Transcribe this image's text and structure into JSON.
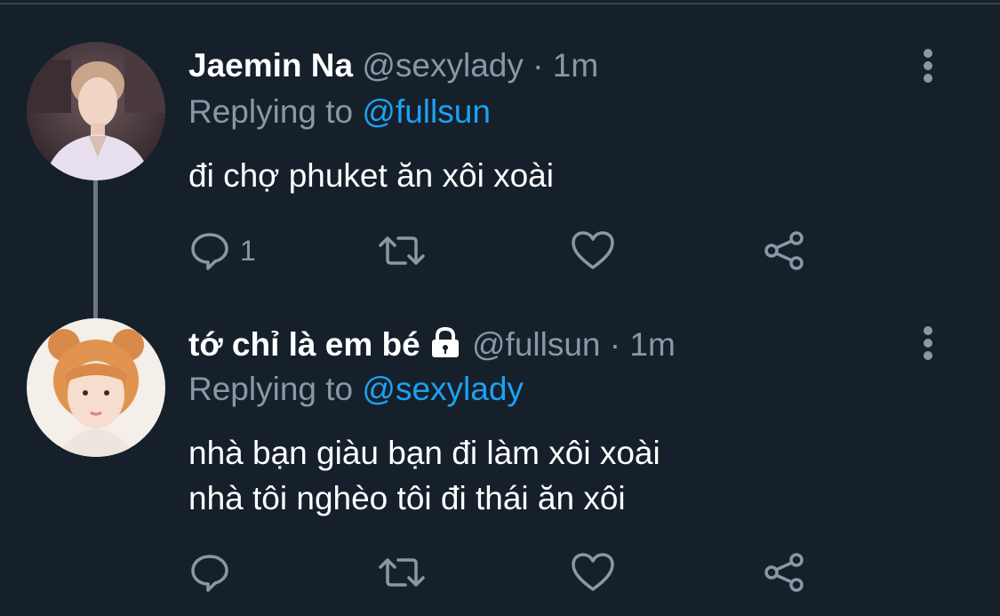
{
  "tweets": [
    {
      "display_name": "Jaemin Na",
      "handle": "@sexylady",
      "dot": "·",
      "time": "1m",
      "replying_prefix": "Replying to",
      "replying_to": "@fullsun",
      "text_lines": [
        "đi chợ phuket ăn xôi xoài"
      ],
      "reply_count": "1",
      "locked": false
    },
    {
      "display_name": "tớ chỉ là em bé",
      "handle": "@fullsun",
      "dot": "·",
      "time": "1m",
      "replying_prefix": "Replying to",
      "replying_to": "@sexylady",
      "text_lines": [
        "nhà bạn giàu bạn đi làm xôi xoài",
        "nhà tôi nghèo tôi đi thái ăn xôi"
      ],
      "reply_count": "",
      "locked": true
    }
  ],
  "colors": {
    "background": "#15202b",
    "text_primary": "#ffffff",
    "text_secondary": "#8899a6",
    "link": "#1da1f2",
    "thread_line": "#6b7781"
  },
  "icons": {
    "reply": "speech-bubble-icon",
    "retweet": "retweet-arrows-icon",
    "like": "heart-outline-icon",
    "share": "share-nodes-icon",
    "more": "vertical-ellipsis-icon",
    "lock": "lock-icon"
  }
}
